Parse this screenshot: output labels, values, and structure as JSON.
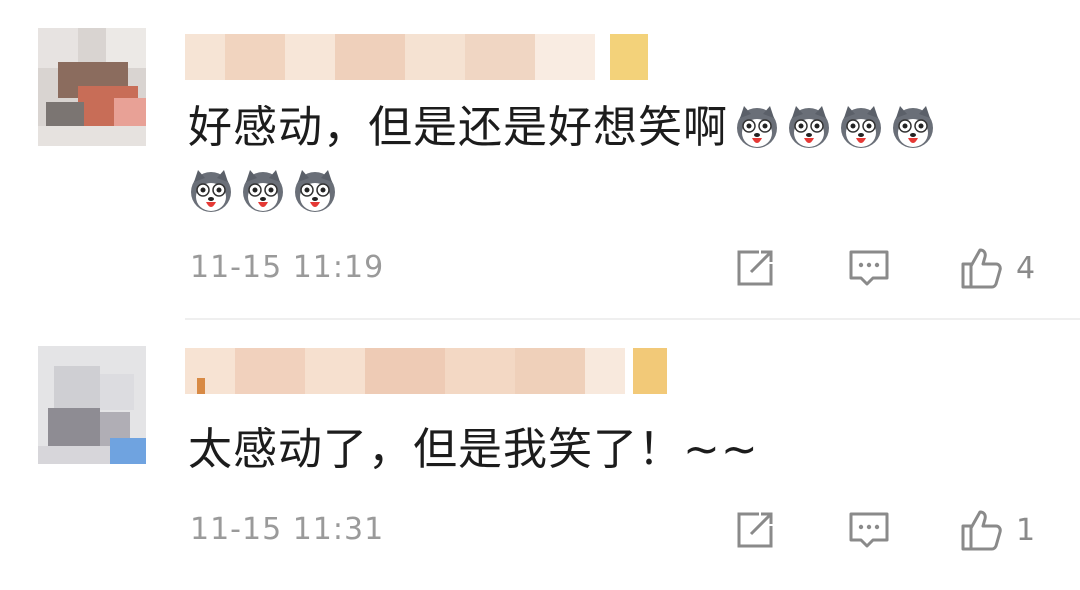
{
  "comments": [
    {
      "text": "好感动，但是还是好想笑啊",
      "time": "11-15 11:19",
      "like_count": "4",
      "emoji_name": "husky-emoji",
      "emoji_count": 7
    },
    {
      "text": "太感动了，但是我笑了！~~",
      "time": "11-15 11:31",
      "like_count": "1"
    }
  ],
  "icons": [
    "share-icon",
    "comment-icon",
    "like-icon"
  ],
  "colors": {
    "text": "#1c1c1c",
    "meta": "#9a9a9a",
    "icon": "#8a8a8a",
    "blur_tint": "#f4d9c4"
  }
}
